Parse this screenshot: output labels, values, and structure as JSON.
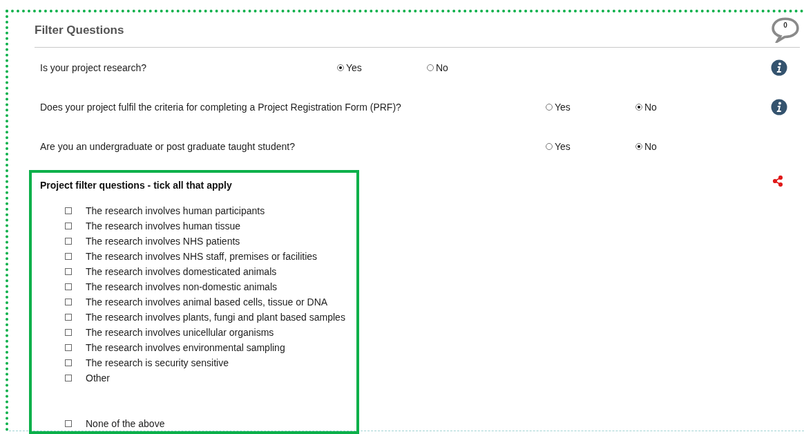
{
  "header": {
    "title": "Filter Questions",
    "comment_count": "0"
  },
  "questions": [
    {
      "text": "Is your project research?",
      "info": true,
      "options": [
        {
          "label": "Yes",
          "selected": true
        },
        {
          "label": "No",
          "selected": false
        }
      ]
    },
    {
      "text": "Does your project fulfil the criteria for completing a Project Registration Form (PRF)?",
      "info": true,
      "options": [
        {
          "label": "Yes",
          "selected": false
        },
        {
          "label": "No",
          "selected": true
        }
      ]
    },
    {
      "text": "Are you an undergraduate or post graduate taught student?",
      "info": false,
      "options": [
        {
          "label": "Yes",
          "selected": false
        },
        {
          "label": "No",
          "selected": true
        }
      ]
    }
  ],
  "checklist": {
    "title": "Project filter questions - tick all that apply",
    "share": true,
    "items": [
      {
        "label": "The research involves human participants",
        "checked": false,
        "kind": "option"
      },
      {
        "label": "The research involves human tissue",
        "checked": false,
        "kind": "option"
      },
      {
        "label": "The research involves NHS patients",
        "checked": false,
        "kind": "option"
      },
      {
        "label": "The research involves NHS staff, premises or facilities",
        "checked": false,
        "kind": "option"
      },
      {
        "label": "The research involves domesticated animals",
        "checked": false,
        "kind": "option"
      },
      {
        "label": "The research involves non-domestic animals",
        "checked": false,
        "kind": "option"
      },
      {
        "label": "The research involves animal based cells, tissue or DNA",
        "checked": false,
        "kind": "option"
      },
      {
        "label": "The research involves plants, fungi and plant based samples",
        "checked": false,
        "kind": "option"
      },
      {
        "label": "The research involves unicellular organisms",
        "checked": false,
        "kind": "option"
      },
      {
        "label": "The research involves environmental sampling",
        "checked": false,
        "kind": "option"
      },
      {
        "label": "The research is security sensitive",
        "checked": false,
        "kind": "option"
      },
      {
        "label": "Other",
        "checked": false,
        "kind": "other"
      },
      {
        "label": "None of the above",
        "checked": false,
        "kind": "option"
      }
    ]
  }
}
